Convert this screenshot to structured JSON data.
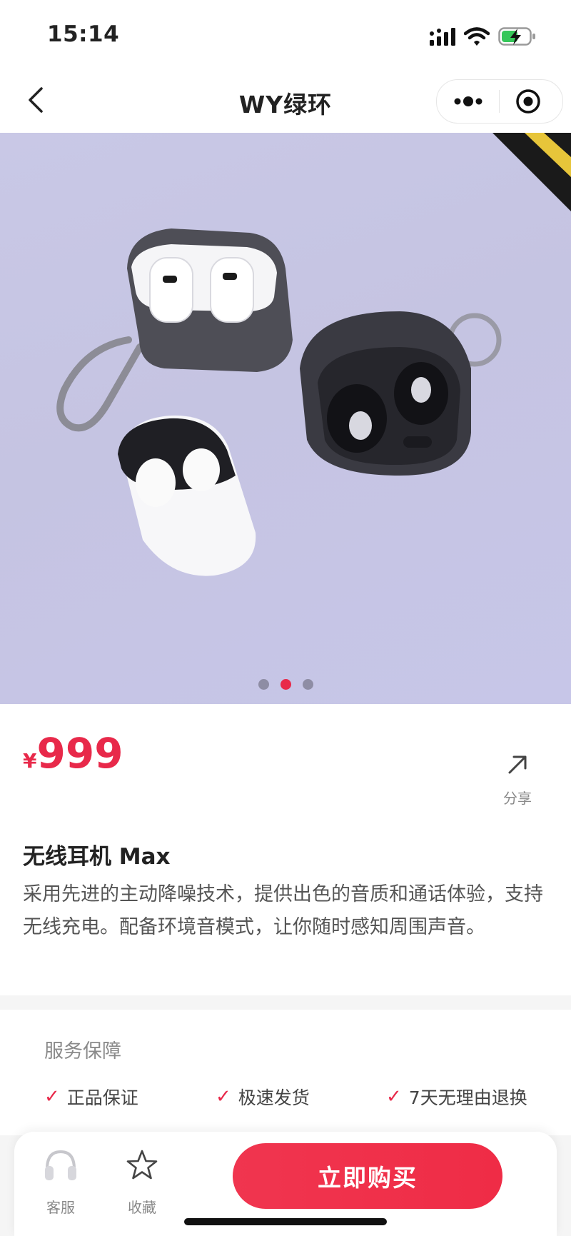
{
  "status_bar": {
    "time": "15:14"
  },
  "nav": {
    "title": "WY绿环"
  },
  "carousel": {
    "total": 3,
    "active_index": 1
  },
  "product": {
    "currency": "¥",
    "price": "999",
    "share_label": "分享",
    "title": "无线耳机 Max",
    "description": "采用先进的主动降噪技术，提供出色的音质和通话体验，支持无线充电。配备环境音模式，让你随时感知周围声音。"
  },
  "services": {
    "title": "服务保障",
    "items": [
      {
        "check": "✓",
        "label": "正品保证"
      },
      {
        "check": "✓",
        "label": "极速发货"
      },
      {
        "check": "✓",
        "label": "7天无理由退换"
      }
    ]
  },
  "bottom_bar": {
    "customer_service": "客服",
    "favorite": "收藏",
    "buy": "立即购买"
  },
  "colors": {
    "accent": "#e8294a",
    "hero_bg": "#c6c5e4"
  }
}
